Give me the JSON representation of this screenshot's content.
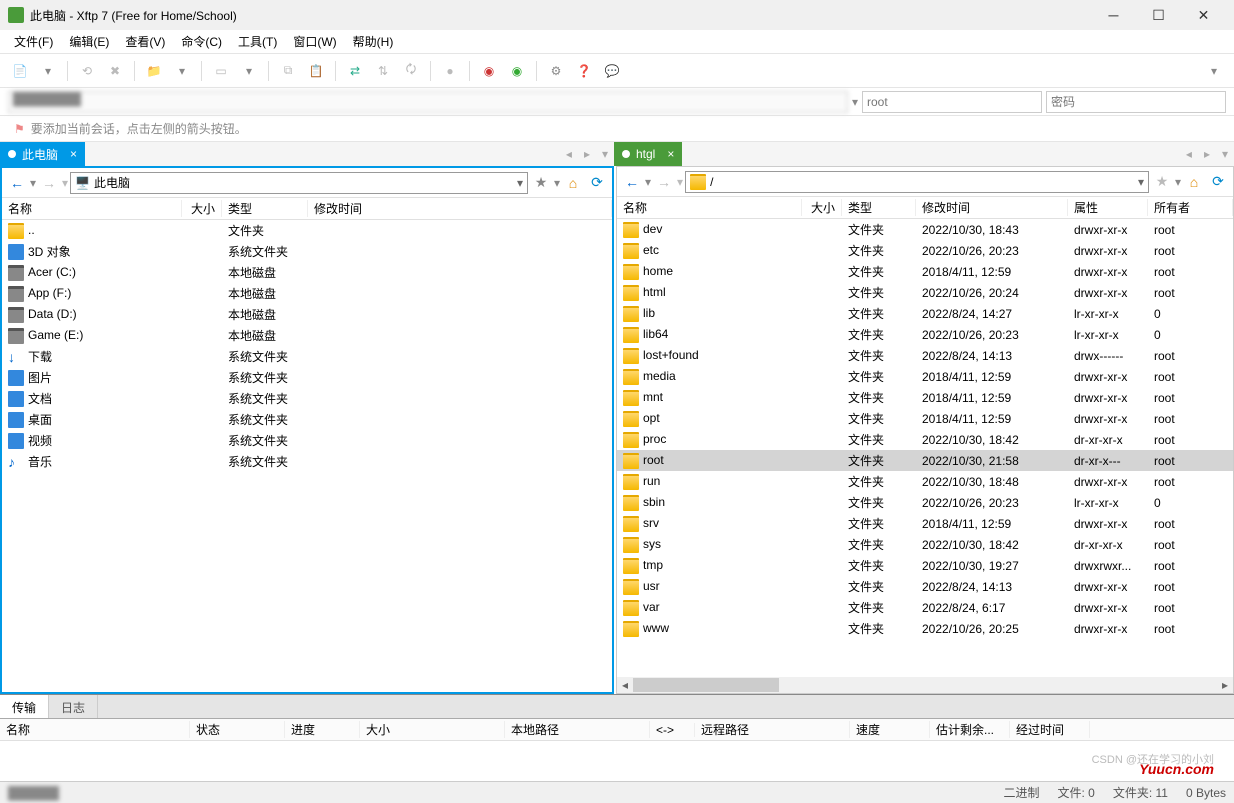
{
  "window": {
    "title": "此电脑 - Xftp 7 (Free for Home/School)"
  },
  "menu": [
    "文件(F)",
    "编辑(E)",
    "查看(V)",
    "命令(C)",
    "工具(T)",
    "窗口(W)",
    "帮助(H)"
  ],
  "hostbar": {
    "user_placeholder": "root",
    "pass_placeholder": "密码"
  },
  "hint": "要添加当前会话，点击左侧的箭头按钮。",
  "tabs": {
    "left": "此电脑",
    "right": "htgl"
  },
  "leftPath": "此电脑",
  "rightPath": "/",
  "cols_local": {
    "name": "名称",
    "size": "大小",
    "type": "类型",
    "modified": "修改时间"
  },
  "cols_remote": {
    "name": "名称",
    "size": "大小",
    "type": "类型",
    "modified": "修改时间",
    "attr": "属性",
    "owner": "所有者"
  },
  "local": [
    {
      "name": "..",
      "type": "文件夹",
      "icon": "folder"
    },
    {
      "name": "3D 对象",
      "type": "系统文件夹",
      "icon": "blue"
    },
    {
      "name": "Acer (C:)",
      "type": "本地磁盘",
      "icon": "disk"
    },
    {
      "name": "App (F:)",
      "type": "本地磁盘",
      "icon": "disk"
    },
    {
      "name": "Data (D:)",
      "type": "本地磁盘",
      "icon": "disk"
    },
    {
      "name": "Game (E:)",
      "type": "本地磁盘",
      "icon": "disk"
    },
    {
      "name": "下载",
      "type": "系统文件夹",
      "icon": "down"
    },
    {
      "name": "图片",
      "type": "系统文件夹",
      "icon": "blue"
    },
    {
      "name": "文档",
      "type": "系统文件夹",
      "icon": "blue"
    },
    {
      "name": "桌面",
      "type": "系统文件夹",
      "icon": "blue"
    },
    {
      "name": "视频",
      "type": "系统文件夹",
      "icon": "blue"
    },
    {
      "name": "音乐",
      "type": "系统文件夹",
      "icon": "music"
    }
  ],
  "remote": [
    {
      "name": "dev",
      "type": "文件夹",
      "modified": "2022/10/30, 18:43",
      "attr": "drwxr-xr-x",
      "owner": "root"
    },
    {
      "name": "etc",
      "type": "文件夹",
      "modified": "2022/10/26, 20:23",
      "attr": "drwxr-xr-x",
      "owner": "root"
    },
    {
      "name": "home",
      "type": "文件夹",
      "modified": "2018/4/11, 12:59",
      "attr": "drwxr-xr-x",
      "owner": "root"
    },
    {
      "name": "html",
      "type": "文件夹",
      "modified": "2022/10/26, 20:24",
      "attr": "drwxr-xr-x",
      "owner": "root"
    },
    {
      "name": "lib",
      "type": "文件夹",
      "modified": "2022/8/24, 14:27",
      "attr": "lr-xr-xr-x",
      "owner": "0"
    },
    {
      "name": "lib64",
      "type": "文件夹",
      "modified": "2022/10/26, 20:23",
      "attr": "lr-xr-xr-x",
      "owner": "0"
    },
    {
      "name": "lost+found",
      "type": "文件夹",
      "modified": "2022/8/24, 14:13",
      "attr": "drwx------",
      "owner": "root"
    },
    {
      "name": "media",
      "type": "文件夹",
      "modified": "2018/4/11, 12:59",
      "attr": "drwxr-xr-x",
      "owner": "root"
    },
    {
      "name": "mnt",
      "type": "文件夹",
      "modified": "2018/4/11, 12:59",
      "attr": "drwxr-xr-x",
      "owner": "root"
    },
    {
      "name": "opt",
      "type": "文件夹",
      "modified": "2018/4/11, 12:59",
      "attr": "drwxr-xr-x",
      "owner": "root"
    },
    {
      "name": "proc",
      "type": "文件夹",
      "modified": "2022/10/30, 18:42",
      "attr": "dr-xr-xr-x",
      "owner": "root"
    },
    {
      "name": "root",
      "type": "文件夹",
      "modified": "2022/10/30, 21:58",
      "attr": "dr-xr-x---",
      "owner": "root",
      "selected": true
    },
    {
      "name": "run",
      "type": "文件夹",
      "modified": "2022/10/30, 18:48",
      "attr": "drwxr-xr-x",
      "owner": "root"
    },
    {
      "name": "sbin",
      "type": "文件夹",
      "modified": "2022/10/26, 20:23",
      "attr": "lr-xr-xr-x",
      "owner": "0"
    },
    {
      "name": "srv",
      "type": "文件夹",
      "modified": "2018/4/11, 12:59",
      "attr": "drwxr-xr-x",
      "owner": "root"
    },
    {
      "name": "sys",
      "type": "文件夹",
      "modified": "2022/10/30, 18:42",
      "attr": "dr-xr-xr-x",
      "owner": "root"
    },
    {
      "name": "tmp",
      "type": "文件夹",
      "modified": "2022/10/30, 19:27",
      "attr": "drwxrwxr...",
      "owner": "root"
    },
    {
      "name": "usr",
      "type": "文件夹",
      "modified": "2022/8/24, 14:13",
      "attr": "drwxr-xr-x",
      "owner": "root"
    },
    {
      "name": "var",
      "type": "文件夹",
      "modified": "2022/8/24, 6:17",
      "attr": "drwxr-xr-x",
      "owner": "root"
    },
    {
      "name": "www",
      "type": "文件夹",
      "modified": "2022/10/26, 20:25",
      "attr": "drwxr-xr-x",
      "owner": "root"
    }
  ],
  "bottomTabs": {
    "transfer": "传输",
    "log": "日志"
  },
  "transferCols": [
    "名称",
    "状态",
    "进度",
    "大小",
    "本地路径",
    "<->",
    "远程路径",
    "速度",
    "估计剩余...",
    "经过时间"
  ],
  "status": {
    "binary": "二进制",
    "files": "文件: 0",
    "folders": "文件夹: 11",
    "bytes": "0 Bytes"
  },
  "watermark": "Yuucn.com",
  "csdn": "CSDN @还在学习的小刘"
}
